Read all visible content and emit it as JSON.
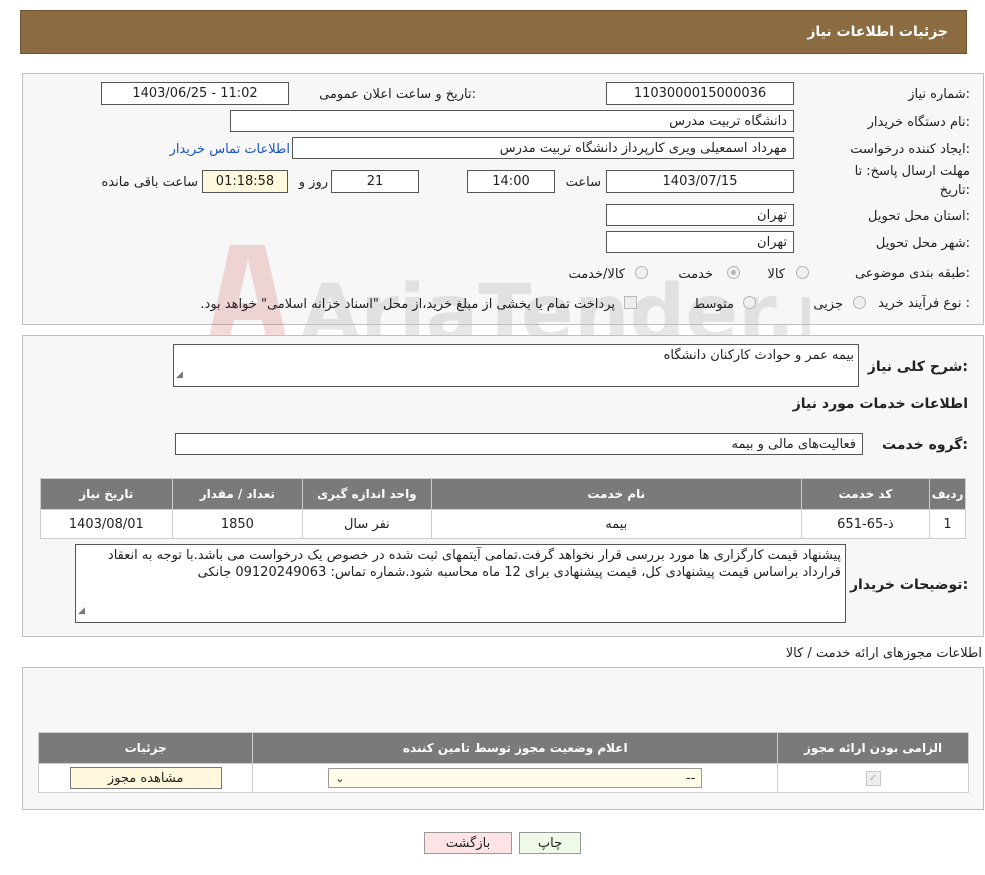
{
  "header": {
    "title": "جزئیات اطلاعات نیاز"
  },
  "form": {
    "need_number_label": "شماره نیاز:",
    "need_number": "1103000015000036",
    "announce_label": "تاریخ و ساعت اعلان عمومی:",
    "announce_value": "1403/06/25 - 11:02",
    "buyer_org_label": "نام دستگاه خریدار:",
    "buyer_org": "دانشگاه تربیت مدرس",
    "requester_label": "ایجاد کننده درخواست:",
    "requester": "مهرداد اسمعیلی ویری کارپرداز دانشگاه تربیت مدرس",
    "contact_link": "اطلاعات تماس خریدار",
    "deadline_label_1": "مهلت ارسال پاسخ: تا",
    "deadline_label_2": "تاریخ:",
    "deadline_date": "1403/07/15",
    "time_label": "ساعت",
    "deadline_time": "14:00",
    "days_value": "21",
    "days_label": "روز و",
    "remaining_time": "01:18:58",
    "remaining_label": "ساعت باقی مانده",
    "province_label": "استان محل تحویل:",
    "province": "تهران",
    "city_label": "شهر محل تحویل:",
    "city": "تهران",
    "category_label": "طبقه بندی موضوعی:",
    "category_options": [
      "کالا",
      "خدمت",
      "کالا/خدمت"
    ],
    "purchase_type_label": "نوع فرآیند خرید :",
    "purchase_options": [
      "جزیی",
      "متوسط"
    ],
    "payment_note": "پرداخت تمام یا بخشی از مبلغ خرید،از محل \"اسناد خزانه اسلامی\" خواهد بود."
  },
  "description": {
    "label": "شرح کلی نیاز:",
    "value": "بیمه عمر و حوادث کارکنان دانشگاه",
    "services_title": "اطلاعات خدمات مورد نیاز",
    "group_label": "گروه خدمت:",
    "group_value": "فعالیت‌های مالی و بیمه"
  },
  "services_table": {
    "headers": [
      "ردیف",
      "کد خدمت",
      "نام خدمت",
      "واحد اندازه گیری",
      "تعداد / مقدار",
      "تاریخ نیاز"
    ],
    "rows": [
      [
        "1",
        "ذ-65-651",
        "بیمه",
        "نفر سال",
        "1850",
        "1403/08/01"
      ]
    ]
  },
  "buyer_notes": {
    "label": "توضیحات خریدار:",
    "text": "پیشنهاد قیمت کارگزاری ها مورد بررسی قرار نخواهد گرفت.تمامی آیتمهای ثبت شده در خصوص یک درخواست می باشد.با توجه به انعقاد قرارداد براساس قیمت پیشنهادی کل، قیمت پیشنهادی برای 12 ماه محاسبه شود.شماره تماس: 09120249063 جانکی"
  },
  "permits": {
    "title": "اطلاعات مجوزهای ارائه خدمت / کالا",
    "headers": [
      "الزامی بودن ارائه مجوز",
      "اعلام وضعیت مجوز توسط تامین کننده",
      "جزئیات"
    ],
    "select_value": "--",
    "view_button": "مشاهده مجوز"
  },
  "buttons": {
    "print": "چاپ",
    "back": "بازگشت"
  },
  "watermark": {
    "text": "AriaTender.neT"
  },
  "colors": {
    "header_bg": "#8b6b40",
    "table_header": "#7a7a7a",
    "link": "#1a55c7",
    "back_button": "#fde3e6",
    "print_button": "#eef9e8"
  }
}
